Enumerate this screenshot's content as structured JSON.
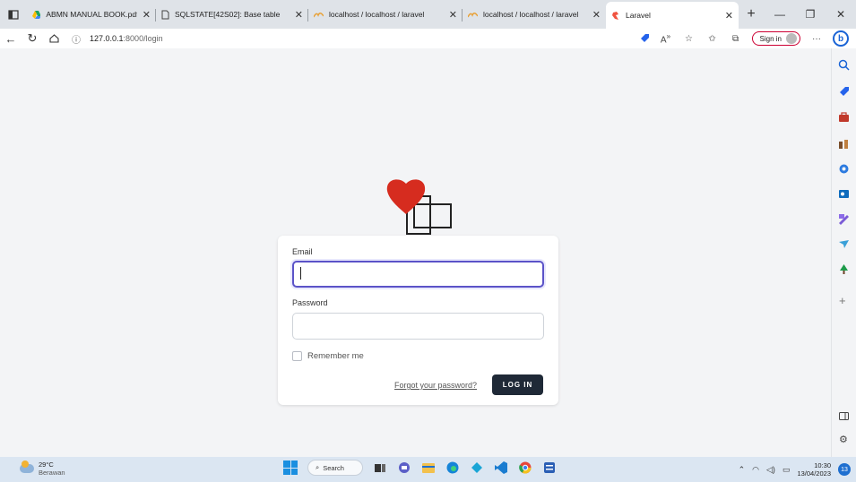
{
  "browser": {
    "tabs": [
      {
        "label": "ABMN MANUAL BOOK.pdf - ",
        "favicon": "google-drive-icon"
      },
      {
        "label": "SQLSTATE[42S02]: Base table",
        "favicon": "page-icon"
      },
      {
        "label": "localhost / localhost / laravel",
        "favicon": "phpmyadmin-icon"
      },
      {
        "label": "localhost / localhost / laravel",
        "favicon": "phpmyadmin-icon"
      },
      {
        "label": "Laravel",
        "favicon": "laravel-icon",
        "active": true
      }
    ],
    "address": {
      "host": "127.0.0.1",
      "path": ":8000/login"
    },
    "signin_label": "Sign in",
    "window_controls": [
      "minimize",
      "restore",
      "close"
    ]
  },
  "login": {
    "email_label": "Email",
    "email_value": "",
    "password_label": "Password",
    "password_value": "",
    "remember_label": "Remember me",
    "remember_checked": false,
    "forgot_label": "Forgot your password?",
    "login_button": "LOG IN"
  },
  "colors": {
    "logo_heart": "#d62c1f",
    "button_bg": "#1f2937",
    "focus_border": "#5b53c8"
  },
  "sidebar": {
    "icons": [
      "search-icon",
      "shopping-tag-icon",
      "toolbox-icon",
      "games-icon",
      "office-icon",
      "outlook-icon",
      "designer-icon",
      "send-icon",
      "tree-icon",
      "add-icon",
      "layout-icon",
      "settings-icon"
    ]
  },
  "taskbar": {
    "weather_temp": "29°C",
    "weather_desc": "Berawan",
    "search_label": "Search",
    "time": "10:30",
    "date": "13/04/2023",
    "notification_count": "13"
  }
}
